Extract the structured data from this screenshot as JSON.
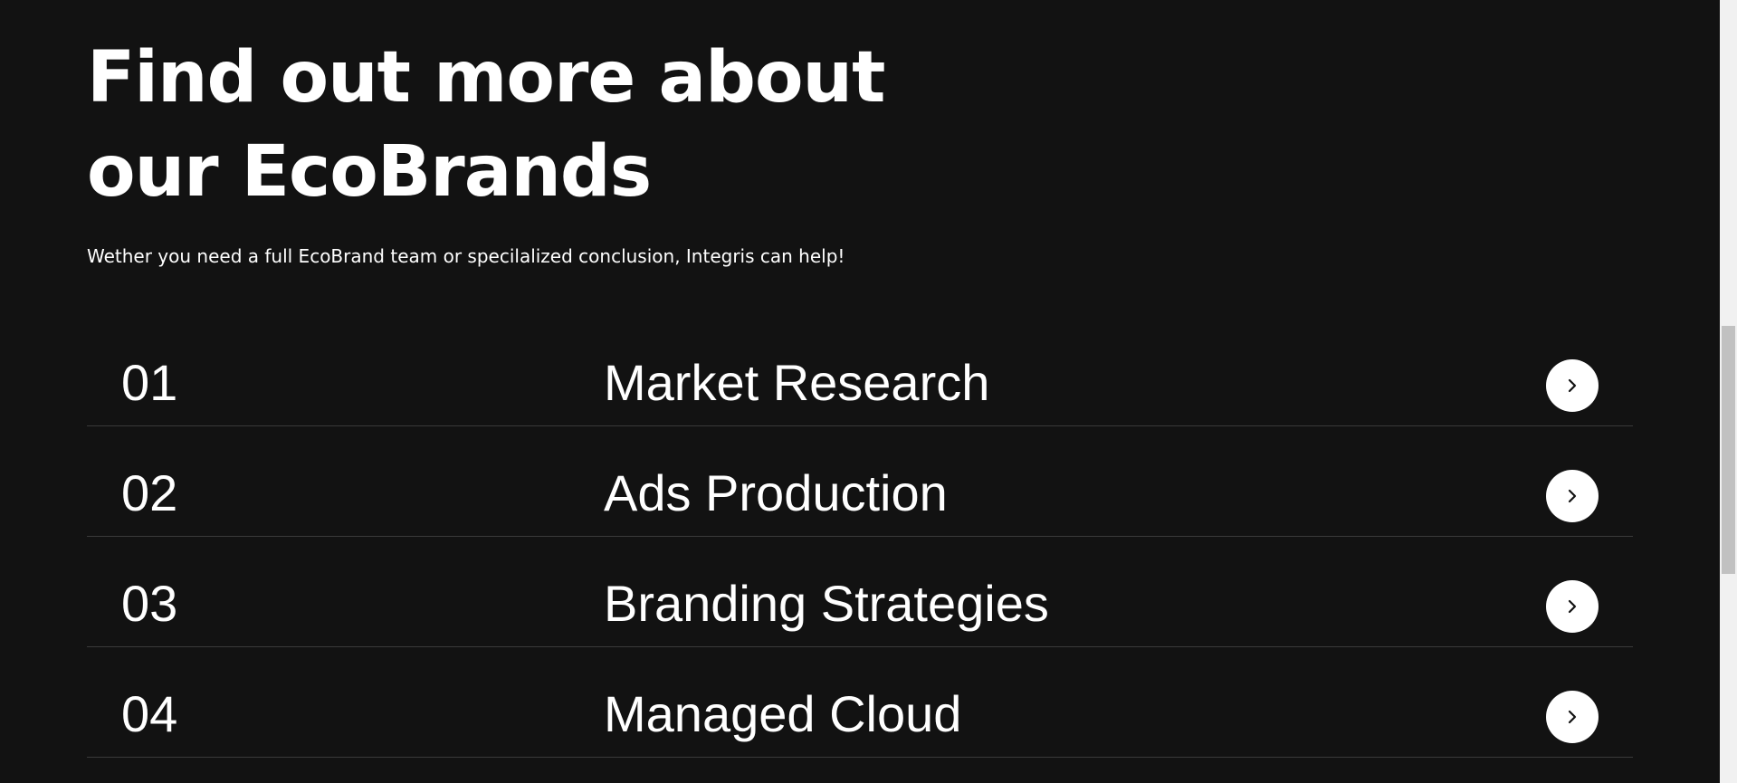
{
  "heading": {
    "line1": "Find out more about",
    "line2": "our EcoBrands"
  },
  "subtitle": "Wether you need a full EcoBrand team or specilalized conclusion, Integris can help!",
  "services": [
    {
      "number": "01",
      "name": "Market Research",
      "icon": "chevron-right-icon"
    },
    {
      "number": "02",
      "name": "Ads Production",
      "icon": "chevron-right-icon"
    },
    {
      "number": "03",
      "name": "Branding Strategies",
      "icon": "chevron-right-icon"
    },
    {
      "number": "04",
      "name": "Managed Cloud",
      "icon": "chevron-right-icon"
    }
  ],
  "colors": {
    "background": "#121212",
    "text": "#ffffff",
    "divider": "#3a3a3a",
    "button": "#ffffff",
    "button_icon": "#121212"
  }
}
